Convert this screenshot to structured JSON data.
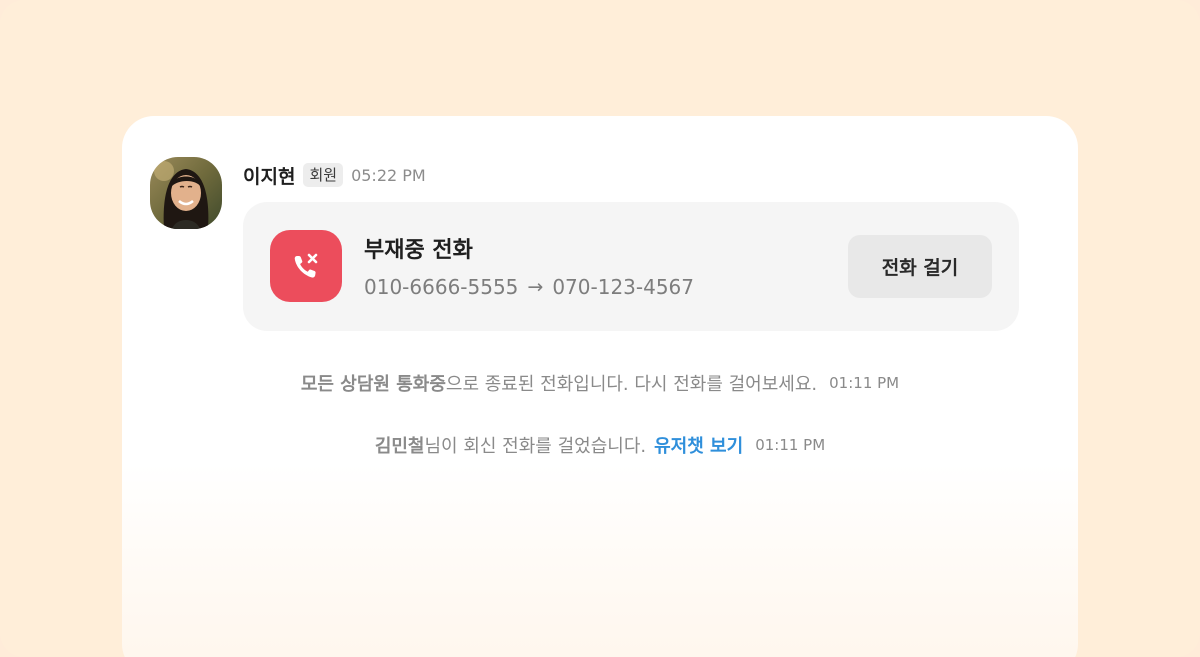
{
  "message": {
    "sender_name": "이지현",
    "sender_badge": "회원",
    "time": "05:22 PM",
    "avatar_icon": "user-photo-avatar"
  },
  "call_card": {
    "icon": "missed-call-icon",
    "icon_color": "#ec4d5c",
    "title": "부재중 전화",
    "from_number": "010-6666-5555",
    "arrow": "→",
    "to_number": "070-123-4567",
    "call_button_label": "전화 걸기"
  },
  "system_messages": [
    {
      "bold": "모든 상담원 통화중",
      "text": "으로 종료된 전화입니다. 다시 전화를 걸어보세요.",
      "time": "01:11 PM"
    },
    {
      "bold": "김민철",
      "text": "님이 회신 전화를 걸었습니다.",
      "link": "유저챗 보기",
      "link_color": "#2f8fdb",
      "time": "01:11 PM"
    }
  ],
  "colors": {
    "background": "#ffeed9",
    "panel": "#ffffff",
    "card": "#f5f5f5"
  }
}
